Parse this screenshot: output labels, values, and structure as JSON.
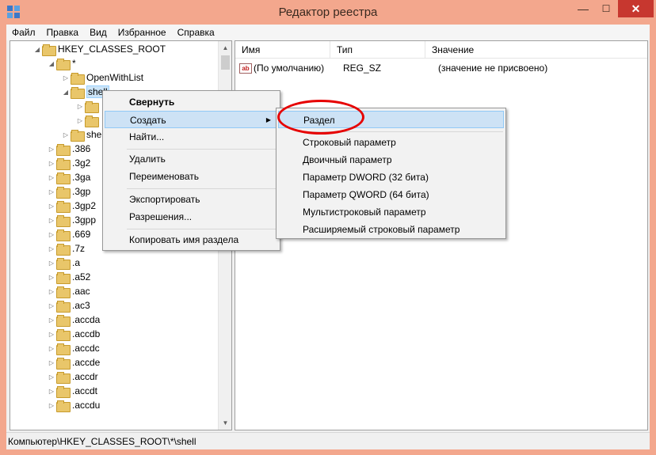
{
  "window": {
    "title": "Редактор реестра",
    "minimize_label": "—",
    "maximize_label": "☐",
    "close_label": "✕"
  },
  "menubar": [
    "Файл",
    "Правка",
    "Вид",
    "Избранное",
    "Справка"
  ],
  "tree": {
    "root": "HKEY_CLASSES_ROOT",
    "star": "*",
    "openwithlist": "OpenWithList",
    "shell": "shell",
    "shell_child_partial": "she",
    "extensions": [
      ".386",
      ".3g2",
      ".3ga",
      ".3gp",
      ".3gp2",
      ".3gpp",
      ".669",
      ".7z",
      ".a",
      ".a52",
      ".aac",
      ".ac3",
      ".accda",
      ".accdb",
      ".accdc",
      ".accde",
      ".accdr",
      ".accdt",
      ".accdu"
    ]
  },
  "list": {
    "columns": {
      "name": "Имя",
      "type": "Тип",
      "value": "Значение"
    },
    "rows": [
      {
        "icon": "ab",
        "name": "(По умолчанию)",
        "type": "REG_SZ",
        "value": "(значение не присвоено)"
      }
    ]
  },
  "status": {
    "path": "Компьютер\\HKEY_CLASSES_ROOT\\*\\shell"
  },
  "context_menu": {
    "collapse": "Свернуть",
    "create": "Создать",
    "find": "Найти...",
    "delete": "Удалить",
    "rename": "Переименовать",
    "export": "Экспортировать",
    "permissions": "Разрешения...",
    "copy_key_name": "Копировать имя раздела"
  },
  "submenu": {
    "key": "Раздел",
    "string": "Строковый параметр",
    "binary": "Двоичный параметр",
    "dword": "Параметр DWORD (32 бита)",
    "qword": "Параметр QWORD (64 бита)",
    "multistring": "Мультистроковый параметр",
    "expandstring": "Расширяемый строковый параметр"
  },
  "colors": {
    "titlebar": "#f3a78d",
    "close": "#c7372f",
    "selection": "#cde2f5",
    "annotation": "#e60000"
  }
}
